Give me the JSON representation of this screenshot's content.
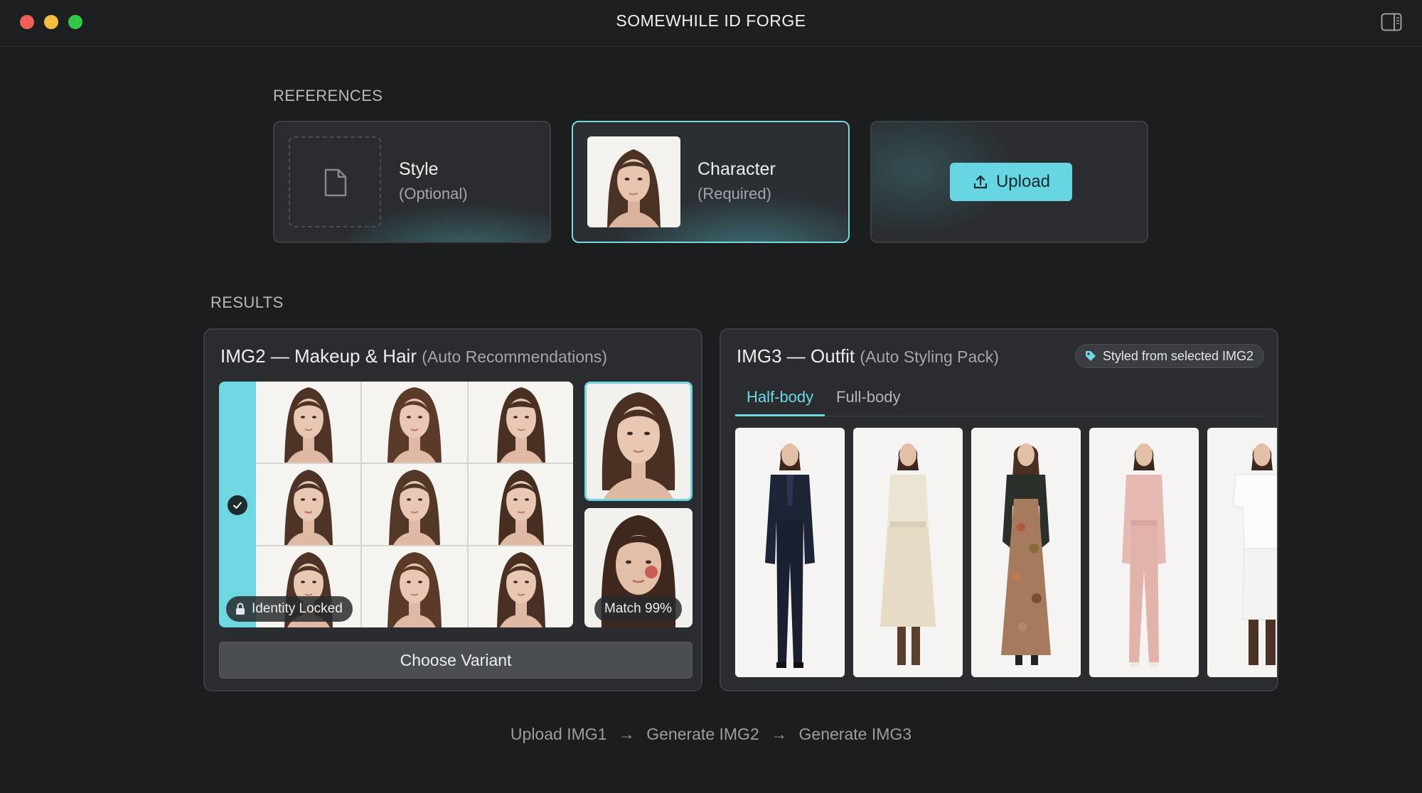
{
  "window": {
    "title": "SOMEWHILE ID FORGE"
  },
  "references": {
    "label": "REFERENCES",
    "style_card": {
      "title": "Style",
      "subtitle": "(Optional)"
    },
    "character_card": {
      "title": "Character",
      "subtitle": "(Required)"
    },
    "upload_card": {
      "button_label": "Upload"
    }
  },
  "results": {
    "label": "RESULTS",
    "img2": {
      "title": "IMG2 — Makeup & Hair",
      "subtitle": "(Auto Recommendations)",
      "identity_badge": "Identity Locked",
      "match_badge": "Match 99%",
      "choose_button": "Choose Variant"
    },
    "img3": {
      "title": "IMG3 — Outfit",
      "subtitle": "(Auto Styling Pack)",
      "styled_chip": "Styled from selected IMG2",
      "tabs": [
        "Half-body",
        "Full-body"
      ],
      "active_tab": "Half-body"
    }
  },
  "workflow": {
    "step1": "Upload IMG1",
    "step2": "Generate IMG2",
    "step3": "Generate IMG3",
    "arrow": "→"
  },
  "colors": {
    "accent": "#6ed7e2",
    "background": "#1c1d1f",
    "panel": "#2a2c2f"
  },
  "icons": [
    "sidebar-toggle-icon",
    "file-icon",
    "upload-icon",
    "check-icon",
    "lock-icon",
    "tag-icon"
  ]
}
